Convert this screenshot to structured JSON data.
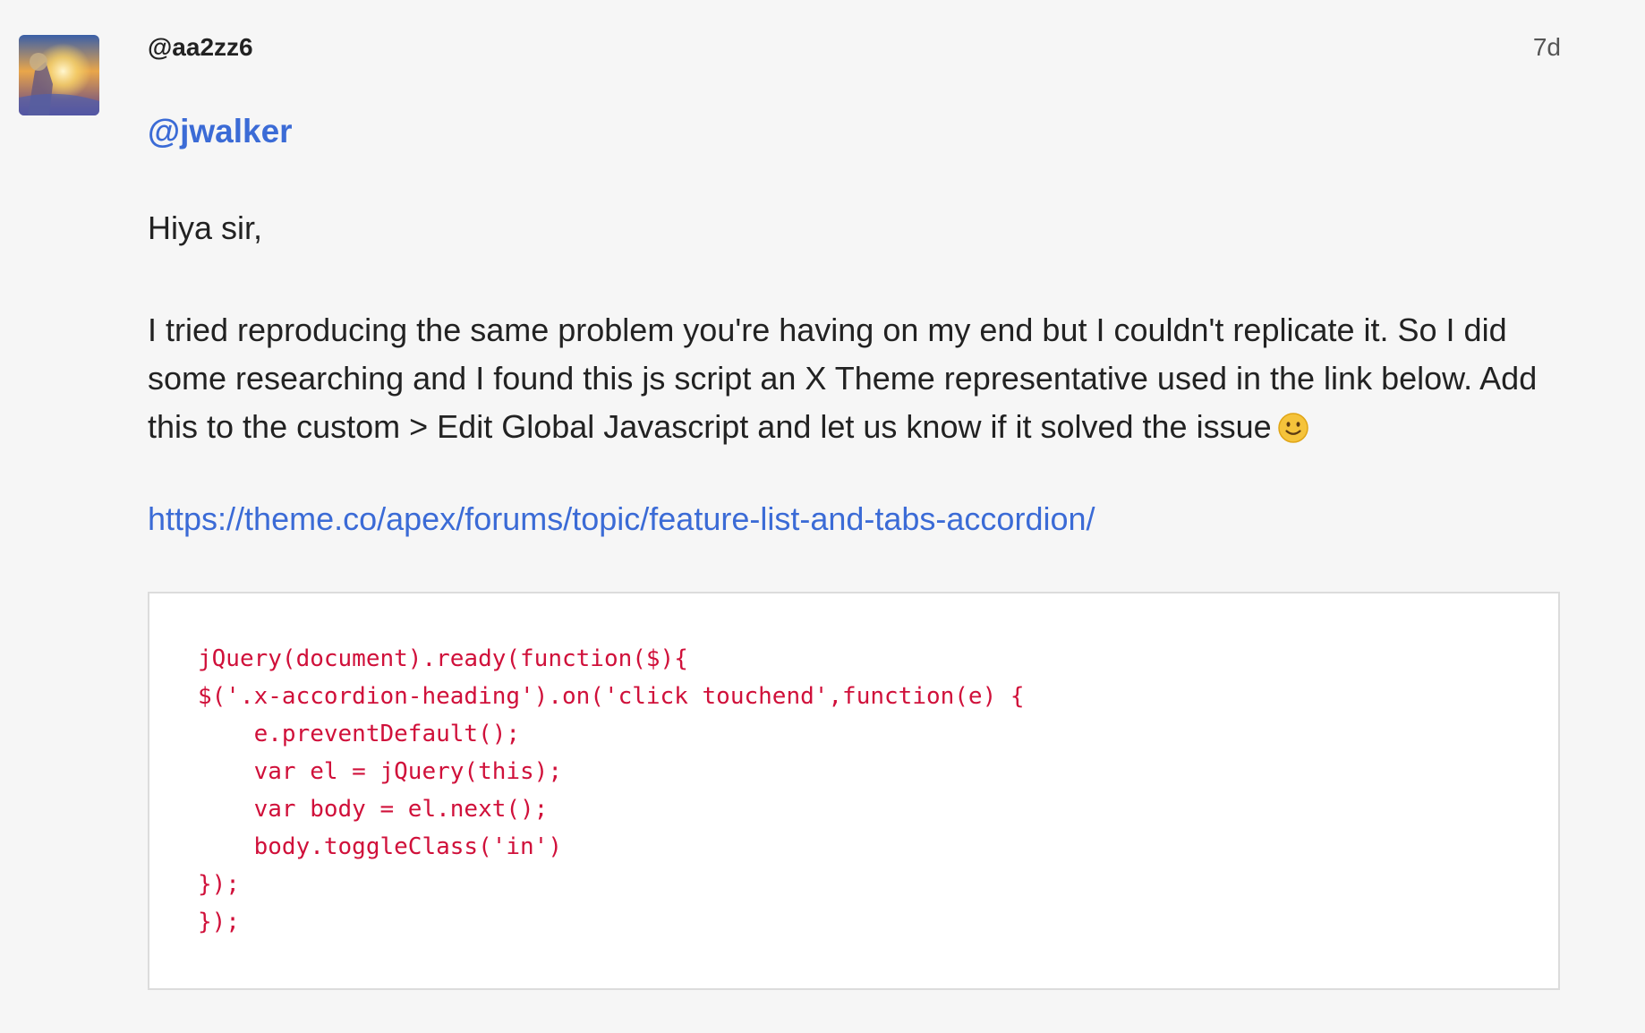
{
  "post": {
    "author": "@aa2zz6",
    "age": "7d",
    "avatar_icon": "user-avatar",
    "mention": "@jwalker",
    "greeting": "Hiya sir,",
    "paragraph": "I tried reproducing the same problem you're having on my end but I couldn't replicate it. So I did some researching and I found this js script an X Theme representative used in the link below. Add this to the custom > Edit Global Javascript and let us know if it solved the issue",
    "emoji": "slightly-smiling-face-icon",
    "link": "https://theme.co/apex/forums/topic/feature-list-and-tabs-accordion/",
    "code_lines": [
      "jQuery(document).ready(function($){",
      "$('.x-accordion-heading').on('click touchend',function(e) {",
      "    e.preventDefault();",
      "    var el = jQuery(this);",
      "    var body = el.next();",
      "    body.toggleClass('in')",
      "});",
      "});"
    ]
  },
  "colors": {
    "background": "#f6f6f6",
    "link": "#3b6bd6",
    "code_text": "#d0103a",
    "code_background": "#ffffff"
  }
}
